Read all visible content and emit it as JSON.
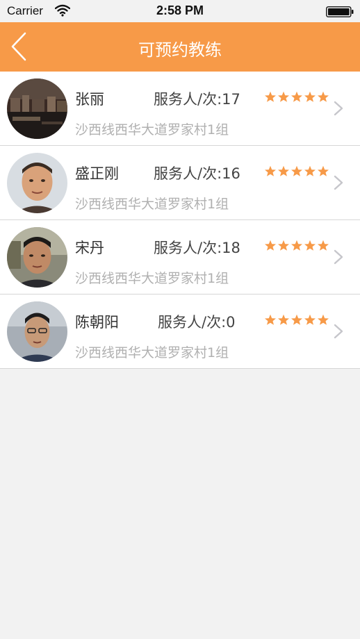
{
  "status_bar": {
    "carrier": "Carrier",
    "time": "2:58 PM"
  },
  "nav": {
    "title": "可预约教练",
    "background": "#f79a48"
  },
  "coaches": [
    {
      "name": "张丽",
      "service": "服务人/次:17",
      "address": "沙西线西华大道罗家村1组",
      "rating": 5
    },
    {
      "name": "盛正刚",
      "service": "服务人/次:16",
      "address": "沙西线西华大道罗家村1组",
      "rating": 5
    },
    {
      "name": "宋丹",
      "service": "服务人/次:18",
      "address": "沙西线西华大道罗家村1组",
      "rating": 5
    },
    {
      "name": "陈朝阳",
      "service": "服务人/次:0",
      "address": "沙西线西华大道罗家村1组",
      "rating": 5
    }
  ],
  "icons": {
    "back": "back-arrow-icon",
    "row_chevron": "chevron-right-icon",
    "star": "star-icon",
    "star_color": "#f79a48"
  }
}
